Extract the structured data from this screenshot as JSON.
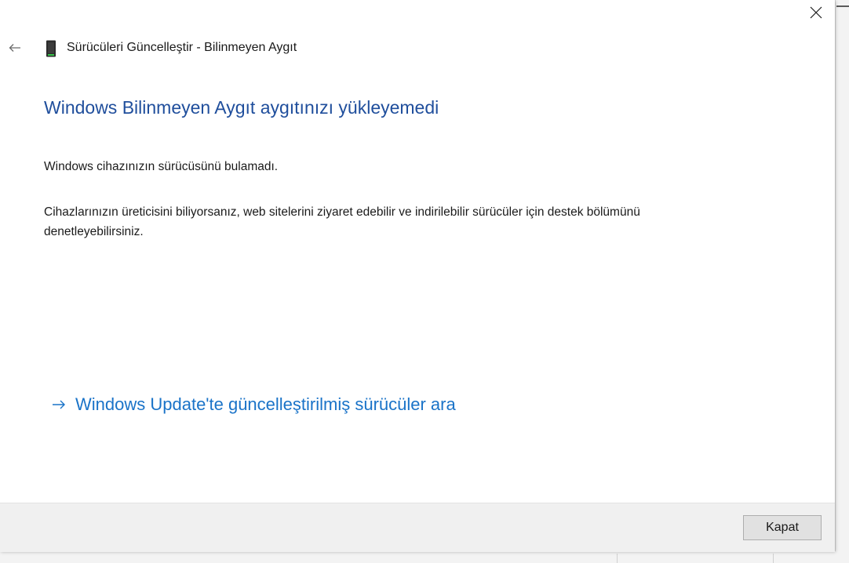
{
  "window": {
    "title": "Sürücüleri Güncelleştir - Bilinmeyen Aygıt"
  },
  "content": {
    "heading": "Windows Bilinmeyen Aygıt aygıtınızı yükleyemedi",
    "message_1": "Windows cihazınızın sürücüsünü bulamadı.",
    "message_2": "Cihazlarınızın üreticisini biliyorsanız, web sitelerini ziyaret edebilir ve indirilebilir sürücüler için destek bölümünü denetleyebilirsiniz.",
    "update_link": "Windows Update'te güncelleştirilmiş sürücüler ara"
  },
  "footer": {
    "close_label": "Kapat"
  },
  "icons": {
    "back": "back-arrow-icon",
    "close": "close-icon",
    "device": "device-icon",
    "link_arrow": "arrow-right-icon"
  },
  "colors": {
    "heading": "#1f4e9c",
    "link": "#1a73c8",
    "footer_bg": "#f0f0f0"
  }
}
